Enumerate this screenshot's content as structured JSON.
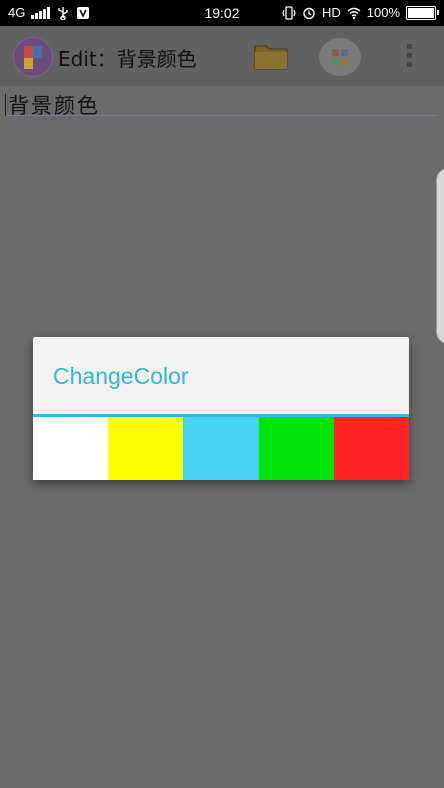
{
  "status_bar": {
    "network": "4G",
    "time": "19:02",
    "hd": "HD",
    "battery": "100%",
    "battery_level": 1.0
  },
  "app_bar": {
    "title": "Edit：背景颜色",
    "icons": [
      "app-logo-icon",
      "folder-icon",
      "palette-icon",
      "overflow-menu-icon"
    ]
  },
  "editor": {
    "text": "背景颜色"
  },
  "dialog": {
    "title": "ChangeColor",
    "accent": "#38b4e6",
    "swatches": [
      {
        "name": "white",
        "color": "#ffffff"
      },
      {
        "name": "yellow",
        "color": "#ffff00"
      },
      {
        "name": "cyan",
        "color": "#44d2f5"
      },
      {
        "name": "green",
        "color": "#00e40a"
      },
      {
        "name": "red",
        "color": "#ff2525"
      }
    ]
  }
}
